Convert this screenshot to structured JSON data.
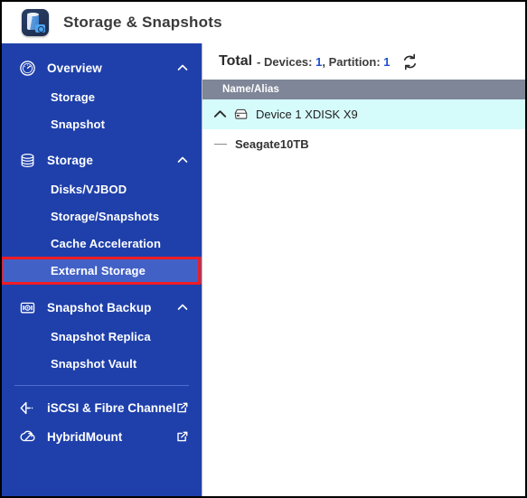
{
  "window": {
    "title": "Storage & Snapshots",
    "app_icon": "storage-snapshots-app-icon"
  },
  "colors": {
    "sidebar_bg": "#1f40ab",
    "sidebar_selected": "#4261c7",
    "highlight_border": "#ee1c25",
    "table_header_bg": "#7e8698",
    "selected_row_bg": "#d6fbfb",
    "accent_number": "#1d4fd0"
  },
  "sidebar": {
    "groups": [
      {
        "label": "Overview",
        "icon": "gauge-icon",
        "chevron": "chevron-up-icon",
        "items": [
          {
            "label": "Storage",
            "selected": false
          },
          {
            "label": "Snapshot",
            "selected": false
          }
        ]
      },
      {
        "label": "Storage",
        "icon": "database-icon",
        "chevron": "chevron-up-icon",
        "items": [
          {
            "label": "Disks/VJBOD",
            "selected": false
          },
          {
            "label": "Storage/Snapshots",
            "selected": false
          },
          {
            "label": "Cache Acceleration",
            "selected": false
          },
          {
            "label": "External Storage",
            "selected": true
          }
        ]
      },
      {
        "label": "Snapshot Backup",
        "icon": "snapshot-camera-icon",
        "chevron": "chevron-up-icon",
        "items": [
          {
            "label": "Snapshot Replica",
            "selected": false
          },
          {
            "label": "Snapshot Vault",
            "selected": false
          }
        ]
      }
    ],
    "links": [
      {
        "label": "iSCSI & Fibre Channel",
        "icon": "iscsi-arrow-icon",
        "external_icon": "external-link-icon"
      },
      {
        "label": "HybridMount",
        "icon": "hybridmount-cloud-icon",
        "external_icon": "external-link-icon"
      }
    ]
  },
  "main": {
    "summary": {
      "total_label": "Total",
      "separator": "-",
      "devices_label": "Devices:",
      "devices_count": "1",
      "comma": ",",
      "partition_label": "Partition:",
      "partition_count": "1",
      "refresh_icon": "refresh-icon"
    },
    "table": {
      "columns": [
        "Name/Alias"
      ],
      "rows": [
        {
          "type": "device",
          "twisty": "chevron-up-icon",
          "icon": "external-disk-icon",
          "name": "Device 1 XDISK X9",
          "selected": true
        },
        {
          "type": "partition",
          "marker": "dash-icon",
          "name": "Seagate10TB",
          "selected": false
        }
      ]
    }
  }
}
